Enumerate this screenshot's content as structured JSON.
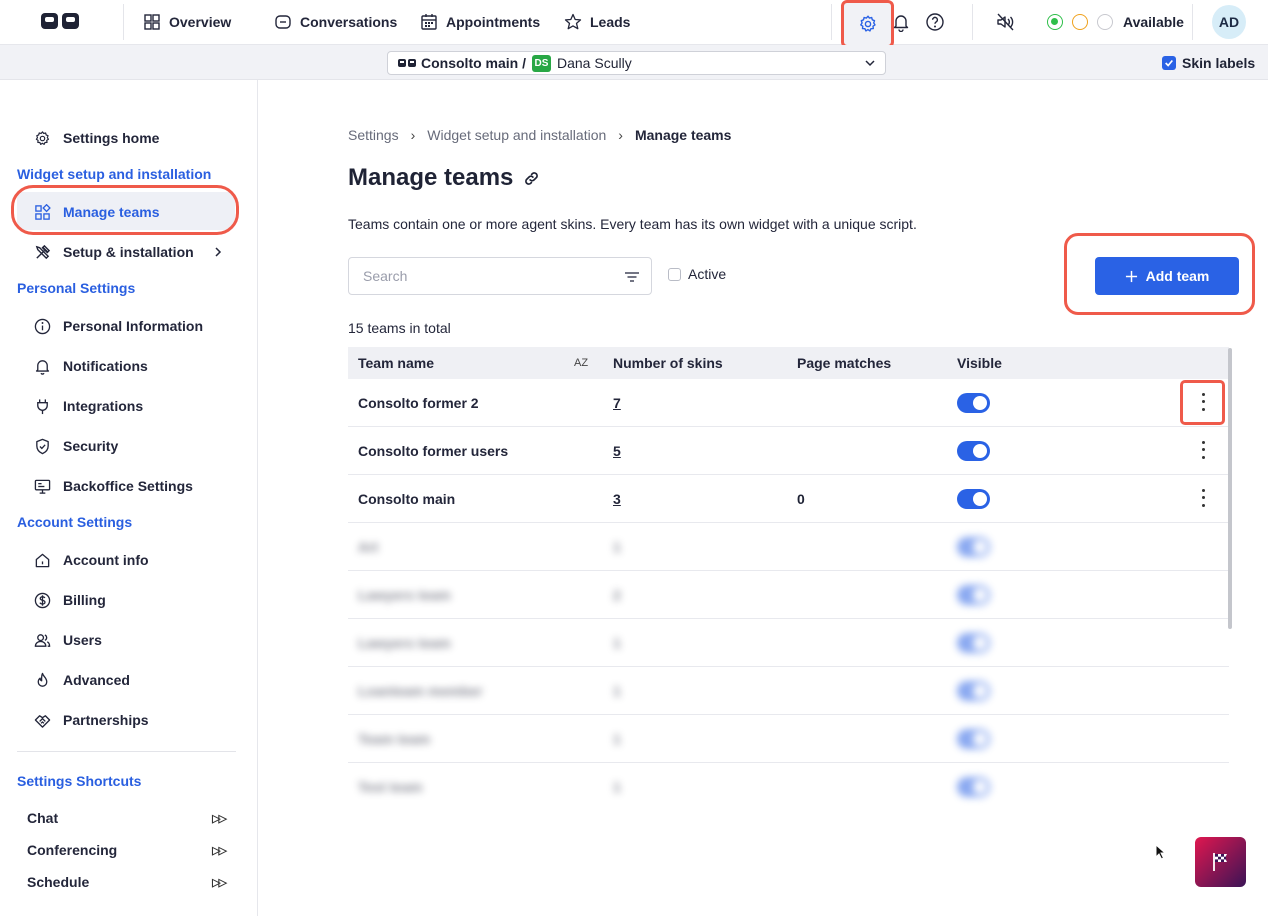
{
  "topnav": {
    "items": [
      {
        "label": "Overview",
        "icon": "grid-icon"
      },
      {
        "label": "Conversations",
        "icon": "chat-bubble-icon"
      },
      {
        "label": "Appointments",
        "icon": "calendar-icon"
      },
      {
        "label": "Leads",
        "icon": "star-icon"
      }
    ],
    "status_label": "Available",
    "avatar_initials": "AD"
  },
  "subbar": {
    "team_label": "Consolto main /",
    "agent_initials": "DS",
    "agent_name": "Dana Scully",
    "skin_labels": "Skin labels"
  },
  "sidebar": {
    "settings_home": "Settings home",
    "section_widget": "Widget setup and installation",
    "manage_teams": "Manage teams",
    "setup_installation": "Setup & installation",
    "section_personal": "Personal Settings",
    "personal_items": [
      "Personal Information",
      "Notifications",
      "Integrations",
      "Security",
      "Backoffice Settings"
    ],
    "section_account": "Account Settings",
    "account_items": [
      "Account info",
      "Billing",
      "Users",
      "Advanced",
      "Partnerships"
    ],
    "section_shortcuts": "Settings Shortcuts",
    "shortcuts": [
      "Chat",
      "Conferencing",
      "Schedule"
    ]
  },
  "main": {
    "breadcrumb": [
      "Settings",
      "Widget setup and installation",
      "Manage teams"
    ],
    "title": "Manage teams",
    "description": "Teams contain one or more agent skins. Every team has its own widget with a unique script.",
    "search_placeholder": "Search",
    "active_label": "Active",
    "add_button": "Add team",
    "total": "15 teams in total",
    "columns": [
      "Team name",
      "Number of skins",
      "Page matches",
      "Visible"
    ],
    "sort_label": "AZ",
    "rows": [
      {
        "name": "Consolto former 2",
        "skins": "7",
        "page_matches": ""
      },
      {
        "name": "Consolto former users",
        "skins": "5",
        "page_matches": ""
      },
      {
        "name": "Consolto main",
        "skins": "3",
        "page_matches": "0"
      }
    ],
    "blurred_rows": [
      {
        "name": "Art",
        "skins": "1"
      },
      {
        "name": "Lawyers team",
        "skins": "2"
      },
      {
        "name": "Lawyers team",
        "skins": "1"
      },
      {
        "name": "Loanteam member",
        "skins": "1"
      },
      {
        "name": "Team team",
        "skins": "1"
      },
      {
        "name": "Test team",
        "skins": "1"
      }
    ]
  },
  "colors": {
    "accent": "#2a62e5",
    "highlight": "#ef5a4a",
    "section": "#2a5fe0"
  }
}
